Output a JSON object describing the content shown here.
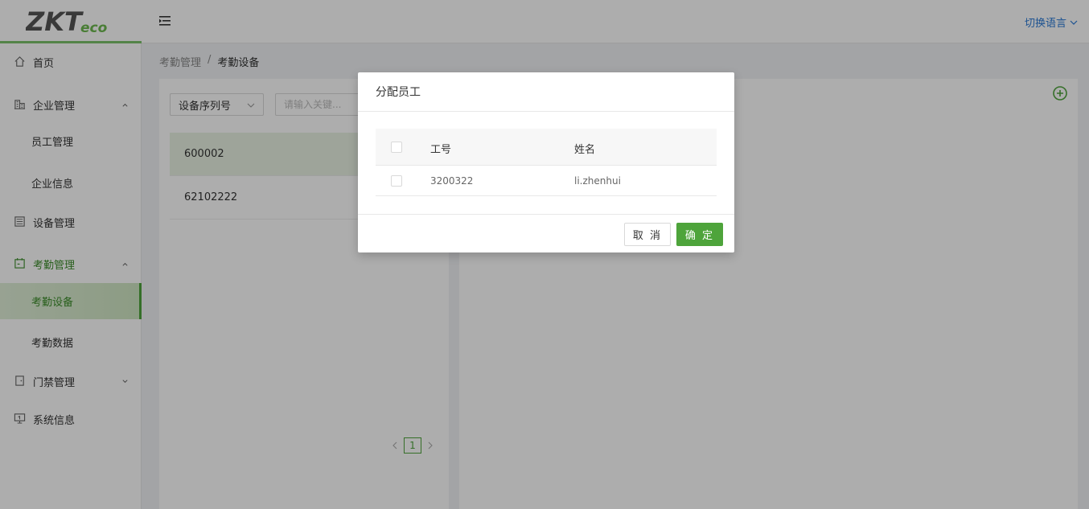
{
  "header": {
    "logo_text": "ZKTeco",
    "lang_label": "切换语言"
  },
  "sidebar": {
    "items": [
      {
        "label": "首页",
        "icon": "home-icon"
      },
      {
        "label": "企业管理",
        "icon": "building-icon"
      },
      {
        "label": "员工管理"
      },
      {
        "label": "企业信息"
      },
      {
        "label": "设备管理",
        "icon": "device-icon"
      },
      {
        "label": "考勤管理",
        "icon": "calendar-icon"
      },
      {
        "label": "考勤设备"
      },
      {
        "label": "考勤数据"
      },
      {
        "label": "门禁管理",
        "icon": "door-icon"
      },
      {
        "label": "系统信息",
        "icon": "monitor-icon"
      }
    ]
  },
  "breadcrumb": {
    "parent": "考勤管理",
    "separator": "/",
    "current": "考勤设备"
  },
  "filter": {
    "select_value": "设备序列号",
    "search_placeholder": "请输入关键..."
  },
  "devices": [
    {
      "serial": "600002"
    },
    {
      "serial": "62102222"
    }
  ],
  "pagination": {
    "current": "1"
  },
  "modal": {
    "title": "分配员工",
    "columns": {
      "id": "工号",
      "name": "姓名"
    },
    "rows": [
      {
        "id": "3200322",
        "name": "li.zhenhui"
      }
    ],
    "cancel_label": "取 消",
    "ok_label": "确 定"
  },
  "colors": {
    "accent": "#4ea43b",
    "link": "#2a7ad6"
  }
}
